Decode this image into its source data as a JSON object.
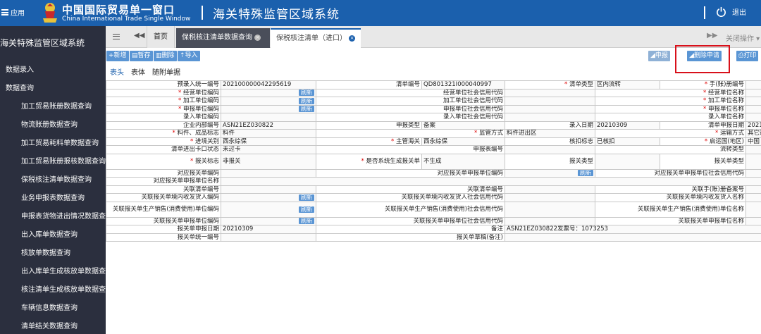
{
  "header": {
    "apps_label": "应用",
    "brand_cn": "中国国际贸易单一窗口",
    "brand_en": "China International Trade Single Window",
    "system_title": "海关特殊监管区域系统",
    "logout_label": "退出"
  },
  "sidebar": {
    "title": "海关特殊监管区域系统",
    "top_items": [
      "数据录入",
      "数据查询"
    ],
    "sub_items": [
      "加工贸易账册数据查询",
      "物流账册数据查询",
      "加工贸易耗料单数据查询",
      "加工贸易账册报核数据查询",
      "保税核注清单数据查询",
      "业务申报表数据查询",
      "申报表货物进出情况数据查询",
      "出入库单数据查询",
      "核放单数据查询",
      "出入库单生成核放单数据查询",
      "核注清单生成核放单数据查询",
      "车辆信息数据查询",
      "清单结关数据查询"
    ]
  },
  "tabs": {
    "home": "首页",
    "tab1": "保税核注清单数据查询",
    "tab2": "保税核注清单（进口）",
    "close_ops": "关闭操作"
  },
  "toolbar": {
    "new": "新增",
    "save": "暂存",
    "delete": "删除",
    "import": "导入",
    "declare": "申报",
    "delete_apply": "删除申请",
    "print": "打印"
  },
  "subtabs": [
    "表头",
    "表体",
    "随附单据"
  ],
  "refresh_label": "刷新",
  "form": {
    "pre_entry_no_label": "预录入统一编号",
    "pre_entry_no": "202100000042295619",
    "list_no_label": "清单编号",
    "list_no": "QD801321I000040997",
    "list_type_label": "清单类型",
    "list_type": "区内流转",
    "manual_no_label": "手(账)册编号",
    "manual_no": "",
    "op_unit_code_label": "经营单位编码",
    "op_unit_credit_label": "经营单位社会信用代码",
    "op_unit_name_label": "经营单位名称",
    "proc_unit_code_label": "加工单位编码",
    "proc_unit_credit_label": "加工单位社会信用代码",
    "proc_unit_name_label": "加工单位名称",
    "decl_unit_code_label": "申报单位编码",
    "decl_unit_credit_label": "申报单位社会信用代码",
    "decl_unit_name_label": "申报单位名称",
    "entry_unit_code_label": "录入单位编码",
    "entry_unit_credit_label": "录入单位社会信用代码",
    "entry_unit_name_label": "录入单位名称",
    "internal_no_label": "企业内部编号",
    "internal_no": "ASN21EZ030822",
    "decl_type_label": "申报类型",
    "decl_type": "备案",
    "entry_date_label": "录入日期",
    "entry_date": "20210309",
    "list_decl_date_label": "清单申报日期",
    "list_decl_date": "20210309",
    "material_flag_label": "料件、成品标志",
    "material_flag": "料件",
    "supervise_mode_label": "监管方式",
    "supervise_mode": "料件进出区",
    "transport_mode_label": "运输方式",
    "transport_mode": "其它运输",
    "port_label": "进境关别",
    "port": "西永综保",
    "customs_label": "主管海关",
    "customs": "西永综保",
    "verify_flag_label": "核扣标志",
    "verify_flag": "已核扣",
    "origin_country_label": "启运国(地区)",
    "origin_country": "中国",
    "gate_status_label": "清单进出卡口状态",
    "gate_status": "未过卡",
    "decl_form_no_label": "申报表编号",
    "decl_form_no": "",
    "flow_type_label": "流转类型",
    "flow_type": "",
    "customs_flag_label": "报关标志",
    "customs_flag": "非报关",
    "auto_gen_label": "是否系统生成报关单",
    "auto_gen": "不生成",
    "customs_type_label": "报关类型",
    "customs_type": "",
    "customs_type2_label": "报关单类型",
    "customs_type2": "",
    "rel_decl_code_label": "对应报关单编码",
    "rel_decl_unit_code_label": "对应报关单申报单位编码",
    "rel_decl_unit_credit_label": "对应报关单申报单位社会信用代码",
    "rel_decl_unit_name_label": "对应报关单申报单位名称",
    "link_list_no_label": "关联清单编号",
    "link_manual_no_label": "关联手(账)册备案号",
    "link_consignee_code_label": "关联报关单境内收发货人编码",
    "link_consignee_credit_label": "关联报关单境内收发货人社会信用代码",
    "link_consignee_name_label": "关联报关单境内收发货人名称",
    "link_producer_code_label": "关联报关单生产销售(消费使用)单位编码",
    "link_producer_credit_label": "关联报关单生产销售(消费使用)社会信用代码",
    "link_producer_name_label": "关联报关单生产销售(消费使用)单位名称",
    "link_decl_unit_code_label": "关联报关单申报单位编码",
    "link_decl_unit_credit_label": "关联报关单申报单位社会信用代码",
    "link_decl_unit_name_label": "关联报关单申报单位名称",
    "customs_decl_date_label": "报关单申报日期",
    "customs_decl_date": "20210309",
    "remark_label": "备注",
    "remark": "ASN21EZ030822发票号：1073253",
    "customs_unified_no_label": "报关单统一编号",
    "customs_draft_no_label": "报关单草稿(备注)"
  }
}
